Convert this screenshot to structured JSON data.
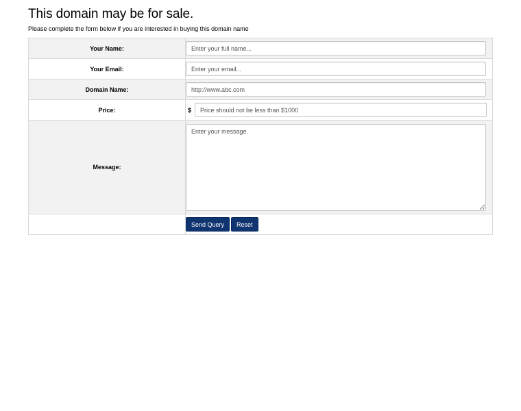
{
  "header": {
    "title": "This domain may be for sale.",
    "subtitle": "Please complete the form below if you are interested in buying this domain name"
  },
  "form": {
    "name": {
      "label": "Your Name:",
      "placeholder": "Enter your full name...",
      "value": ""
    },
    "email": {
      "label": "Your Email:",
      "placeholder": "Enter your email...",
      "value": ""
    },
    "domain": {
      "label": "Domain Name:",
      "placeholder": "http://www.abc.com",
      "value": ""
    },
    "price": {
      "label": "Price:",
      "currency": "$",
      "placeholder": "Price should not be less than $1000",
      "value": ""
    },
    "message": {
      "label": "Message:",
      "placeholder": "Enter your message.",
      "value": ""
    },
    "buttons": {
      "send_label": "Send Query",
      "reset_label": "Reset"
    }
  },
  "colors": {
    "button_bg": "#0f3470",
    "shaded_row_bg": "#f2f2f2",
    "border": "#d9d9d9"
  }
}
